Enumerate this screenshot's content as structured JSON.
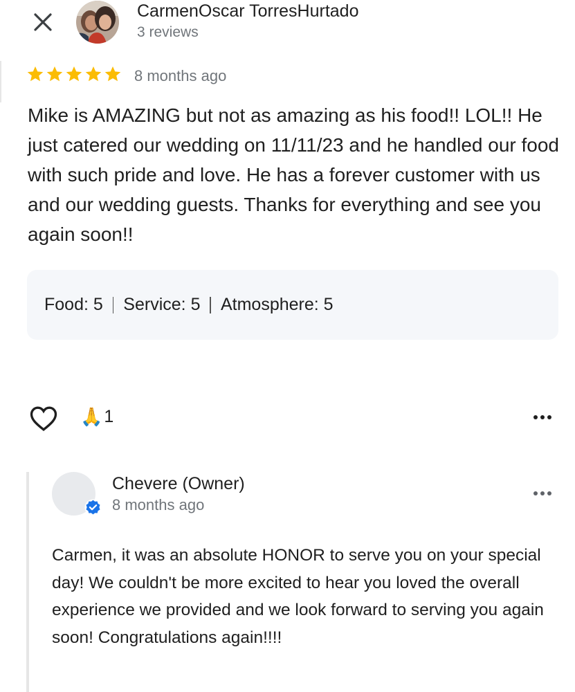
{
  "review": {
    "author_name": "CarmenOscar TorresHurtado",
    "author_meta": "3 reviews",
    "rating": 5,
    "rating_max": 5,
    "date": "8 months ago",
    "text": "Mike is AMAZING but not as amazing as his food!! LOL!! He just catered our wedding on 11/11/23 and he handled our food with such pride and love. He has a forever customer with us and our wedding guests. Thanks for everything and see you again soon!!",
    "subratings": [
      {
        "label": "Food:",
        "value": "5"
      },
      {
        "label": "Service:",
        "value": "5"
      },
      {
        "label": "Atmosphere:",
        "value": "5"
      }
    ],
    "reaction_emoji": "🙏",
    "reaction_count": "1"
  },
  "reply": {
    "owner_name": "Chevere (Owner)",
    "date": "8 months ago",
    "text": "Carmen, it was an absolute HONOR to serve you on your special day! We couldn't be more excited to hear you loved the overall experience we provided and we look forward to serving you again soon! Congratulations again!!!!"
  },
  "icons": {
    "close": "close-icon",
    "star": "star-icon",
    "like": "heart-outline-icon",
    "more": "more-horizontal-icon",
    "verified": "verified-badge-icon"
  },
  "colors": {
    "star": "#fbbc04",
    "verified": "#1a73e8",
    "secondary_text": "#70757a",
    "ratings_box_bg": "#f5f7fa"
  }
}
